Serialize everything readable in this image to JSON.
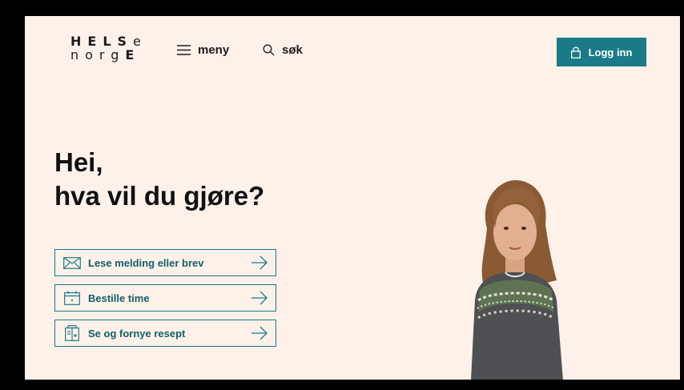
{
  "logo": {
    "row1": "HELSe",
    "row2": "norgE",
    "row1_caps": "HELS",
    "row1_tail": "e",
    "row2_head": "norg",
    "row2_caps": "E"
  },
  "nav": {
    "menu_label": "meny",
    "search_label": "søk",
    "menu_icon": "hamburger-icon",
    "search_icon": "search-icon"
  },
  "login": {
    "label": "Logg inn",
    "icon": "lock-icon",
    "color": "#1b7a87"
  },
  "heading": {
    "line1": "Hei,",
    "line2": "hva vil du gjøre?"
  },
  "actions": [
    {
      "label": "Lese melding eller brev",
      "icon": "envelope-icon"
    },
    {
      "label": "Bestille time",
      "icon": "calendar-icon"
    },
    {
      "label": "Se og fornye resept",
      "icon": "prescription-icon"
    }
  ],
  "hero_image": {
    "subject": "child-in-knitted-sweater"
  },
  "colors": {
    "background": "#fdf1ea",
    "accent": "#1b7a87",
    "text": "#111111"
  }
}
